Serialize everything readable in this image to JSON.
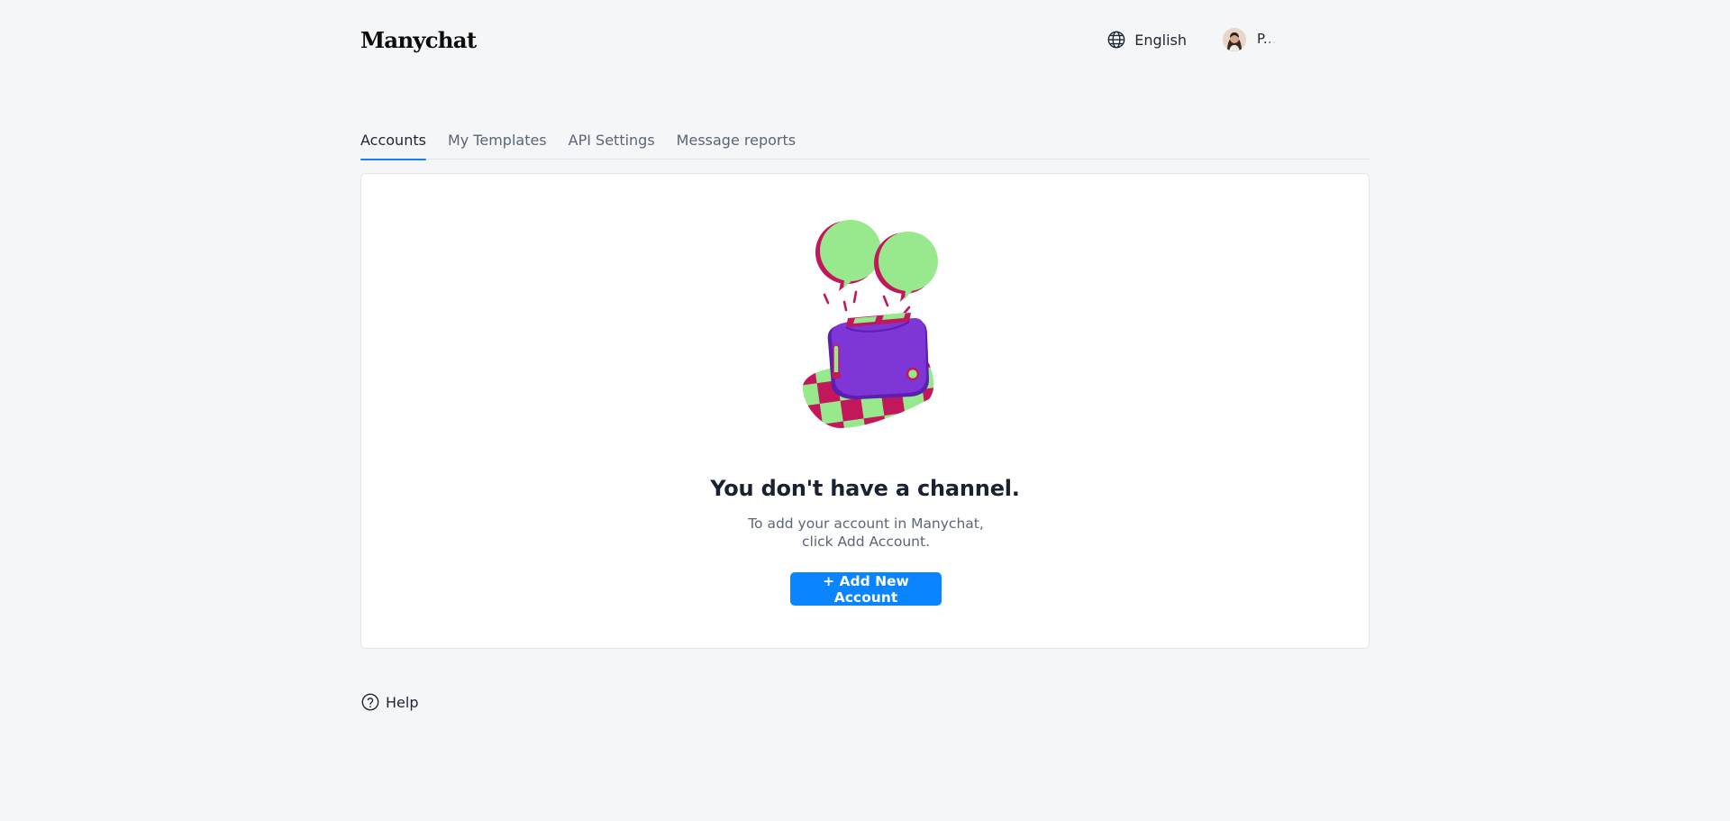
{
  "header": {
    "logo_text": "Manychat",
    "language": {
      "label": "English",
      "icon": "globe-icon"
    },
    "user": {
      "name": "P...",
      "avatar_icon": "avatar"
    }
  },
  "tabs": [
    {
      "label": "Accounts",
      "active": true
    },
    {
      "label": "My Templates",
      "active": false
    },
    {
      "label": "API Settings",
      "active": false
    },
    {
      "label": "Message reports",
      "active": false
    }
  ],
  "empty_state": {
    "illustration_icon": "toaster-chat-bubbles-illustration",
    "title": "You don't have a channel.",
    "description": "To add your account in Manychat, click Add Account.",
    "button_label": "+ Add New Account"
  },
  "footer": {
    "help_label": "Help",
    "help_icon": "question-circle-icon"
  },
  "colors": {
    "background": "#f5f6f8",
    "accent": "#0a84ff",
    "tab_active_underline": "#1b7bf2",
    "illustration_green": "#98e88d",
    "illustration_magenta": "#c2185b",
    "illustration_purple": "#7e36d6"
  }
}
